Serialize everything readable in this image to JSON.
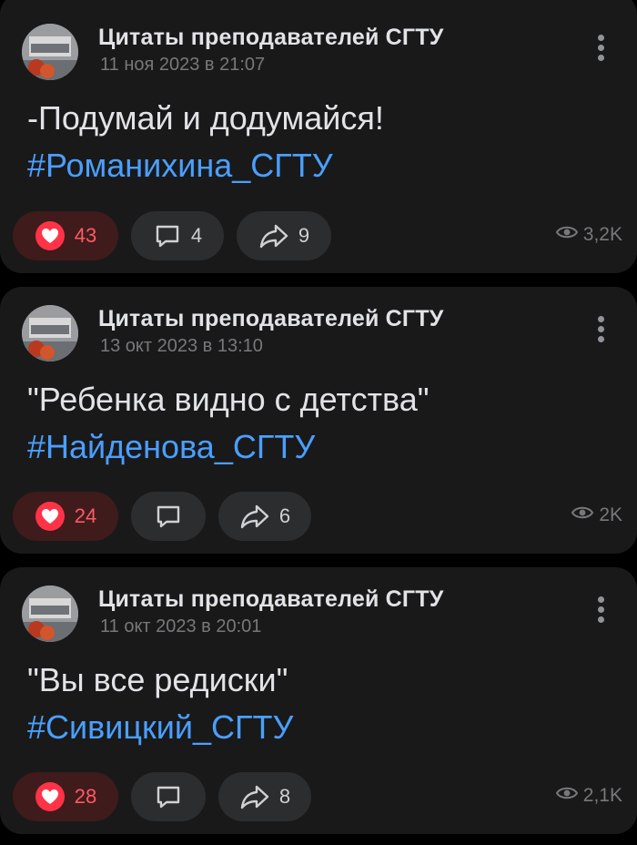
{
  "posts": [
    {
      "author": "Цитаты преподавателей СГТУ",
      "date": "11 ноя 2023 в 21:07",
      "text": "-Подумай и додумайся!",
      "hashtag": "#Романихина_СГТУ",
      "likes": "43",
      "comments": "4",
      "reposts": "9",
      "views": "3,2K"
    },
    {
      "author": "Цитаты преподавателей СГТУ",
      "date": "13 окт 2023 в 13:10",
      "text": "\"Ребенка видно с детства\"",
      "hashtag": "#Найденова_СГТУ",
      "likes": "24",
      "comments": "",
      "reposts": "6",
      "views": "2K"
    },
    {
      "author": "Цитаты преподавателей СГТУ",
      "date": "11 окт 2023 в 20:01",
      "text": "\"Вы все редиски\"",
      "hashtag": "#Сивицкий_СГТУ",
      "likes": "28",
      "comments": "",
      "reposts": "8",
      "views": "2,1K"
    }
  ],
  "icons": {
    "like": "heart-icon",
    "comment": "comment-icon",
    "repost": "share-icon",
    "views": "eye-icon",
    "more": "more-vertical-icon"
  },
  "colors": {
    "background": "#000000",
    "card": "#19191a",
    "hashtag": "#4a9fff",
    "like_active": "#ff3347",
    "like_bg": "#3f1b1c"
  }
}
